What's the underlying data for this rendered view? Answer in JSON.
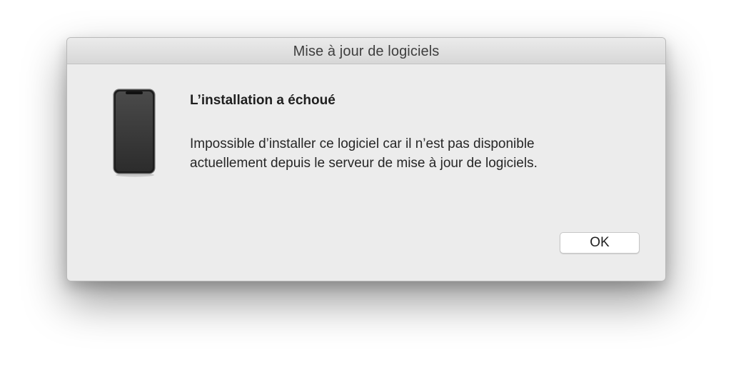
{
  "window": {
    "title": "Mise à jour de logiciels"
  },
  "dialog": {
    "icon": "iphone-device-icon",
    "heading": "L’installation a échoué",
    "message_line1": "Impossible d’installer ce logiciel car il n’est pas disponible",
    "message_line2": "actuellement depuis le serveur de mise à jour de logiciels.",
    "ok_label": "OK"
  },
  "colors": {
    "window_bg": "#ececec",
    "titlebar_bg": "#dcdcdc",
    "device_body": "#2a2a2a"
  }
}
